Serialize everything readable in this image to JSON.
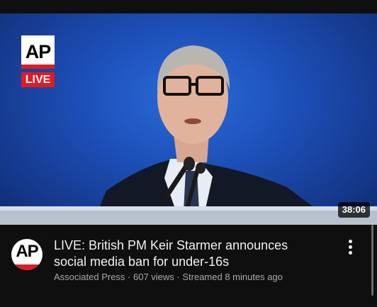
{
  "thumbnail": {
    "logo_text": "AP",
    "live_label": "LIVE",
    "duration": "38:06"
  },
  "video": {
    "title": "LIVE: British PM Keir Starmer announces social media ban for under-16s",
    "channel": "Associated Press",
    "views": "607 views",
    "streamed": "Streamed 8 minutes ago",
    "subtitle": "Associated Press · 607 views · Streamed 8 minutes ago"
  },
  "channel_avatar": {
    "text": "AP"
  },
  "colors": {
    "background": "#0f0f0f",
    "ap_red": "#e21b23",
    "thumbnail_blue": "#1d4fb8",
    "title_text": "#f1f1f1",
    "meta_text": "#aaaaaa"
  },
  "icons": {
    "more": "more-vertical-icon"
  }
}
